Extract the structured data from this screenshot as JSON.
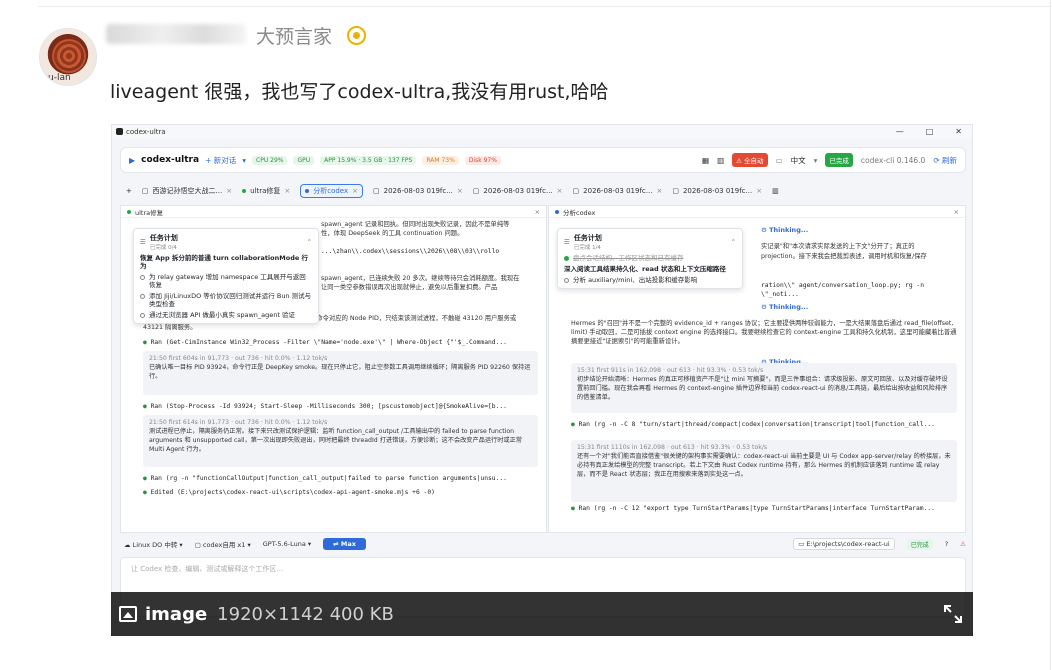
{
  "post": {
    "user_title": "大预言家",
    "avatar_caption": "u-lan",
    "text": "liveagent 很强，我也写了codex-ultra,我没有用rust,哈哈"
  },
  "image_overlay": {
    "label": "image",
    "meta": "1920×1142 400 KB"
  },
  "app": {
    "window_title": "codex-ultra",
    "window_controls": [
      "—",
      "□",
      "✕"
    ],
    "name": "codex-ultra",
    "new_chat": "+ 新对话",
    "stats": [
      "CPU 29%",
      "GPU",
      "APP 15.9% · 3.5 GB · 137 FPS",
      "RAM 73%",
      "Disk 97%"
    ],
    "alert": "⚠ 全自动",
    "lang": "中文",
    "done_badge": "已完成",
    "version": "codex-cli 0.146.0",
    "refresh": "刷新"
  },
  "tabs": [
    {
      "label": "西游记孙悟空大战二...",
      "active": false
    },
    {
      "label": "ultra修复",
      "active": false
    },
    {
      "label": "分析codex",
      "active": true
    },
    {
      "label": "2026-08-03 019fc...",
      "active": false
    },
    {
      "label": "2026-08-03 019fc...",
      "active": false
    },
    {
      "label": "2026-08-03 019fc...",
      "active": false
    },
    {
      "label": "2026-08-03 019fc...",
      "active": false
    }
  ],
  "left_pane": {
    "title": "ultra修复",
    "plan": {
      "title": "任务计划",
      "progress": "已完成 0/4",
      "items": [
        "恢复 App 拆分前的普通 turn collaborationMode 行为",
        "为 relay gateway 增加 namespace 工具展开与返回恢复",
        "添加 Jiji/LinuxDO 等价协议回归测试并运行 Bun 测试与类型检查",
        "通过无浏览器 API 做最小真实 spawn_agent 验证"
      ]
    },
    "snip1": "spawn_agent 记录和回执。但同时出现失败记录，因此不是单纯等",
    "snip2": "性，体现 DeepSeek 的工具 continuation 问题。",
    "snip3": "...\\zhan\\\\.codex\\\\sessions\\\\2026\\\\08\\\\03\\\\rollo",
    "snip4": "spawn_agent，已连续失败 20 多次。继续等待只会消耗额度。我现在",
    "snip5": "让同一类空参数错误再次出现就停止，避免以后重复扣费。产品",
    "snip6": "该进程后端不支持发送 Ctrl+C，我会先精确定位这条 smoke 命令对应的 Node PID，只结束该测试进程，不触碰 43120 用户服务或 43121 隔离服务。",
    "run1": "Ran (Get-CimInstance Win32_Process -Filter \\\"Name='node.exe'\\\" | Where-Object {\"'$_.Command...",
    "blk1_meta": "21:50  first 604s  in 91,773 · out 736 · hit 0.0% · 1.12 tok/s",
    "blk1_text": "已确认唯一目标 PID 93924，命令行正是 DeepKey smoke。现在只停止它，阻止空参数工具调用继续循环；隔离服务 PID 92260 保持运行。",
    "run2": "Ran (Stop-Process -Id 93924; Start-Sleep -Milliseconds 300; [pscustomobject]@{SmokeAlive=[b...",
    "blk2_meta": "21:50  first 614s  in 91,773 · out 736 · hit 0.0% · 1.12 tok/s",
    "blk2_text": "测试进程已停止，隔离服务仍正常。接下来只改测试保护逻辑：监听 function_call_output /工具输出中的 failed to parse function arguments 和 unsupported call，第一次出现即失败退出，同时把最终 threadId 打进错误，方便诊断；这不会改变产品运行时或正常 Multi Agent 行为。",
    "run3": "Ran (rg -n \"functionCallOutput|function_call_output|failed to parse function arguments|unsu...",
    "edited": "Edited (E:\\projects\\codex-react-ui\\scripts\\codex-api-agent-smoke.mjs +6 -0)"
  },
  "right_pane": {
    "title": "分析codex",
    "thinking": "Thinking...",
    "plan": {
      "title": "任务计划",
      "progress": "已完成 1/4",
      "items": [
        "盘点会话结构、工作区状态和已有缓存",
        "深入阅读工具结果持久化、read 状态和上下文压缩路径",
        "分析 auxiliary/mini、出站投影和缓存影响"
      ]
    },
    "snip1": "实记录\"和\"本次请求实际发送的上下文\"分开了；真正的",
    "snip2": "projection。接下来我会把裁剪表述，调用时机和恢复/保存",
    "snip3": "ration\\\\\" agent/conversation_loop.py; rg -n \\\"_noti...",
    "snip4": "Hermes 的\"召回\"并不是一个完整的 evidence_id + ranges 协议；它主要提供两种较弱能力，一是大结果落盘后通过 read_file(offset, limit) 手动取回，二是可插拔 context engine 的选择接口。我要继续检查它的 context-engine 工具和持久化机制，这里可能藏着比普通摘要更接近\"证据索引\"的可能重新设计。",
    "blk1_meta": "15:31  first 911s  in 162,098 · out 613 · hit 93.3% · 0.53 tok/s",
    "blk1_text": "初步结论开始清晰：Hermes 的真正可移植资产不是\"让 mini 写摘要\"，而是三件事组合：请求级投影、原文可回放、以及对缓存破坏设置前回门槛。现在我会再看 Hermes 的 context-engine 插件边界和当前 codex-react-ui 的消息/工具链，最后给出按收益和风险排序的借鉴清单。",
    "run1": "Ran (rg -n -C 8 \"turn/start|thread/compact|codex|conversation|transcript|tool|function_call...",
    "blk2_meta": "15:31  first 1110s  in 162,098 · out 613 · hit 93.3% · 0.53 tok/s",
    "blk2_text": "还有一个对\"我们能否直接借鉴\"很关键的架构事实需要确认：codex-react-ui 当前主要是 UI 与 Codex app-server/relay 的桥接层，未必持有真正发给模型的完整 transcript。若上下文由 Rust Codex runtime 持有，那么 Hermes 的机制应该落到 runtime 或 relay 层，而不是 React 状态层；我正在用搜索来落到实处这一点。",
    "run2": "Ran (rg -n -C 12 \"export type TurnStartParams|type TurnStartParams|interface TurnStartParam..."
  },
  "bottom": {
    "env": "Linux DO 中转",
    "agent": "codex自用 x1",
    "model": "GPT-5.6-Luna",
    "max": "Max",
    "path": "E:\\projects\\codex-react-ui",
    "status": "已完成",
    "input_placeholder": "让 Codex 检查、编辑、测试或解释这个工作区..."
  },
  "colors": {
    "accent": "#2f6bd8",
    "success": "#27a645",
    "danger": "#e34a33"
  }
}
